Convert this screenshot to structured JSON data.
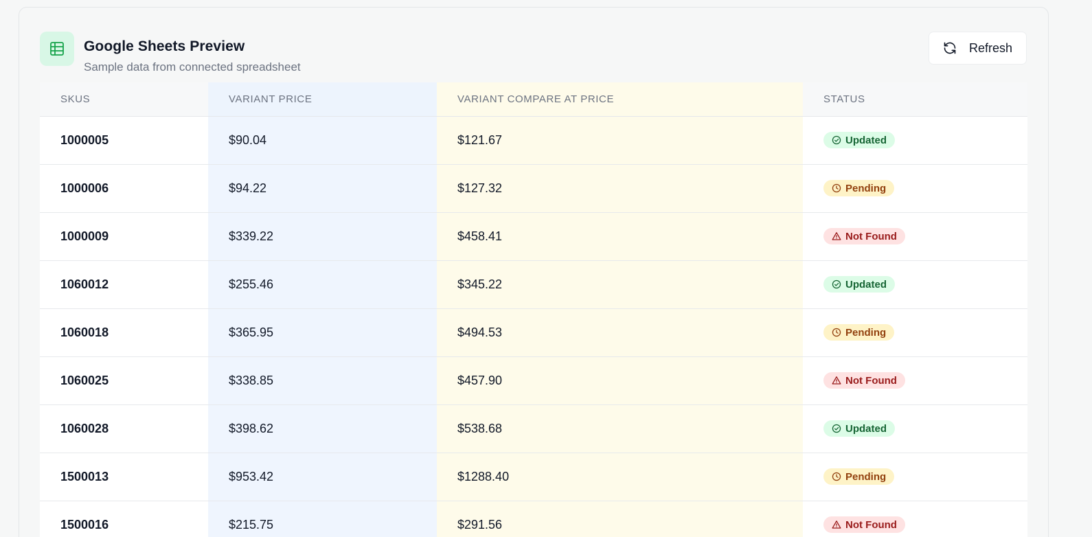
{
  "header": {
    "title": "Google Sheets Preview",
    "subtitle": "Sample data from connected spreadsheet",
    "icon": "spreadsheet-icon",
    "refresh_label": "Refresh",
    "refresh_icon": "refresh-icon"
  },
  "table": {
    "columns": [
      "SKUS",
      "VARIANT PRICE",
      "VARIANT COMPARE AT PRICE",
      "STATUS"
    ],
    "rows": [
      {
        "sku": "1000005",
        "price": "$90.04",
        "compare": "$121.67",
        "status": "Updated"
      },
      {
        "sku": "1000006",
        "price": "$94.22",
        "compare": "$127.32",
        "status": "Pending"
      },
      {
        "sku": "1000009",
        "price": "$339.22",
        "compare": "$458.41",
        "status": "Not Found"
      },
      {
        "sku": "1060012",
        "price": "$255.46",
        "compare": "$345.22",
        "status": "Updated"
      },
      {
        "sku": "1060018",
        "price": "$365.95",
        "compare": "$494.53",
        "status": "Pending"
      },
      {
        "sku": "1060025",
        "price": "$338.85",
        "compare": "$457.90",
        "status": "Not Found"
      },
      {
        "sku": "1060028",
        "price": "$398.62",
        "compare": "$538.68",
        "status": "Updated"
      },
      {
        "sku": "1500013",
        "price": "$953.42",
        "compare": "$1288.40",
        "status": "Pending"
      },
      {
        "sku": "1500016",
        "price": "$215.75",
        "compare": "$291.56",
        "status": "Not Found"
      }
    ]
  },
  "status_styles": {
    "Updated": {
      "icon": "check-circle-icon",
      "color": "#166534",
      "bg": "#dcfce7"
    },
    "Pending": {
      "icon": "clock-icon",
      "color": "#92400e",
      "bg": "#fef3c7"
    },
    "Not Found": {
      "icon": "warning-triangle-icon",
      "color": "#991b1b",
      "bg": "#fee2e2"
    }
  }
}
